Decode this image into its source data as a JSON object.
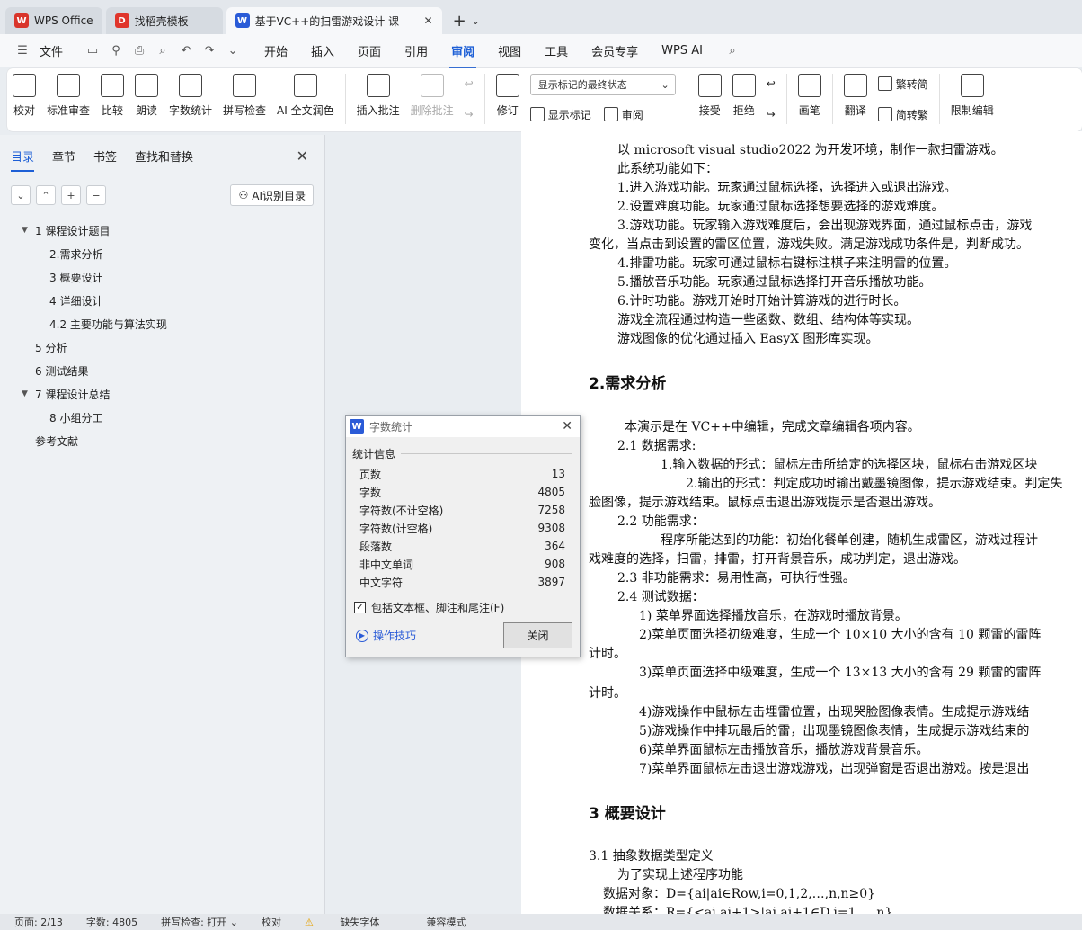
{
  "tabs": [
    {
      "label": "WPS Office",
      "logo": "W",
      "color": "#d9352b"
    },
    {
      "label": "找稻壳模板",
      "logo": "D",
      "color": "#e0352b"
    },
    {
      "label": "基于VC++的扫雷游戏设计 课",
      "logo": "W",
      "color": "#2a5bd7"
    }
  ],
  "menu": {
    "file": "文件",
    "items": [
      "开始",
      "插入",
      "页面",
      "引用",
      "审阅",
      "视图",
      "工具",
      "会员专享",
      "WPS AI"
    ],
    "active_index": 4
  },
  "ribbon": {
    "group1": [
      "校对",
      "标准审查",
      "比较",
      "朗读",
      "字数统计",
      "拼写检查",
      "AI 全文润色"
    ],
    "insert_comment": "插入批注",
    "delete_comment": "删除批注",
    "revise": "修订",
    "markup_select": "显示标记的最终状态",
    "show_markup": "显示标记",
    "review": "审阅",
    "accept": "接受",
    "reject": "拒绝",
    "pen": "画笔",
    "translate": "翻译",
    "to_trad": "繁转简",
    "to_simp": "简转繁",
    "restrict": "限制编辑"
  },
  "nav": {
    "tabs": [
      "目录",
      "章节",
      "书签",
      "查找和替换"
    ],
    "ai_button": "AI识别目录",
    "toc": [
      {
        "label": "1  课程设计题目",
        "level": 0,
        "arrow": true
      },
      {
        "label": "2.需求分析",
        "level": 1,
        "arrow": false
      },
      {
        "label": "3  概要设计",
        "level": 1,
        "arrow": false
      },
      {
        "label": "4 详细设计",
        "level": 1,
        "arrow": false
      },
      {
        "label": "4.2  主要功能与算法实现",
        "level": 1,
        "arrow": false
      },
      {
        "label": "5  分析",
        "level": 0,
        "arrow": false
      },
      {
        "label": "6  测试结果",
        "level": 0,
        "arrow": false
      },
      {
        "label": "7    课程设计总结",
        "level": 0,
        "arrow": true
      },
      {
        "label": "8  小组分工",
        "level": 1,
        "arrow": false
      },
      {
        "label": "参考文献",
        "level": 0,
        "arrow": false
      }
    ]
  },
  "doc": {
    "lines": [
      "以 microsoft visual studio2022 为开发环境，制作一款扫雷游戏。",
      "此系统功能如下：",
      "1.进入游戏功能。玩家通过鼠标选择，选择进入或退出游戏。",
      "2.设置难度功能。玩家通过鼠标选择想要选择的游戏难度。",
      "3.游戏功能。玩家输入游戏难度后，会出现游戏界面，通过鼠标点击，游戏",
      "变化，当点击到设置的雷区位置，游戏失败。满足游戏成功条件是，判断成功。",
      "4.排雷功能。玩家可通过鼠标右键标注棋子来注明雷的位置。",
      "5.播放音乐功能。玩家通过鼠标选择打开音乐播放功能。",
      "6.计时功能。游戏开始时开始计算游戏的进行时长。",
      "游戏全流程通过构造一些函数、数组、结构体等实现。",
      "游戏图像的优化通过插入 EasyX 图形库实现。",
      "本演示是在 VC++中编辑，完成文章编辑各项内容。",
      "2.1  数据需求:",
      "1.输入数据的形式：鼠标左击所给定的选择区块，鼠标右击游戏区块",
      "2.输出的形式：判定成功时输出戴墨镜图像，提示游戏结束。判定失",
      "脸图像，提示游戏结束。鼠标点击退出游戏提示是否退出游戏。",
      "2.2 功能需求：",
      "程序所能达到的功能：初始化餐单创建，随机生成雷区，游戏过程计",
      "戏难度的选择，扫雷，排雷，打开背景音乐，成功判定，退出游戏。",
      "2.3  非功能需求：易用性高，可执行性强。",
      "2.4  测试数据：",
      "1)  菜单界面选择播放音乐，在游戏时播放背景。",
      "2)菜单页面选择初级难度，生成一个 10×10 大小的含有 10 颗雷的雷阵",
      "计时。",
      "3)菜单页面选择中级难度，生成一个 13×13 大小的含有 29 颗雷的雷阵",
      "计时。",
      "4)游戏操作中鼠标左击埋雷位置，出现哭脸图像表情。生成提示游戏结",
      "5)游戏操作中排玩最后的雷，出现墨镜图像表情，生成提示游戏结束的",
      "6)菜单界面鼠标左击播放音乐，播放游戏背景音乐。",
      "7)菜单界面鼠标左击退出游戏游戏，出现弹窗是否退出游戏。按是退出",
      "3.1  抽象数据类型定义",
      "为了实现上述程序功能",
      "数据对象：D={ai|ai∈Row,i=0,1,2,…,n,n≥0}",
      "数据关系：R={<ai,ai+1>|ai,ai+1∈D,i=1,…,n}"
    ],
    "h2": "2.需求分析",
    "h3": "3  概要设计"
  },
  "dialog": {
    "title": "字数统计",
    "section": "统计信息",
    "rows": [
      {
        "k": "页数",
        "v": "13"
      },
      {
        "k": "字数",
        "v": "4805"
      },
      {
        "k": "字符数(不计空格)",
        "v": "7258"
      },
      {
        "k": "字符数(计空格)",
        "v": "9308"
      },
      {
        "k": "段落数",
        "v": "364"
      },
      {
        "k": "非中文单词",
        "v": "908"
      },
      {
        "k": "中文字符",
        "v": "3897"
      }
    ],
    "checkbox": "包括文本框、脚注和尾注(F)",
    "tips": "操作技巧",
    "close": "关闭"
  },
  "status": [
    "页面: 2/13",
    "字数: 4805",
    "拼写检查: 打开 ⌄",
    "校对",
    "缺失字体",
    "兼容模式"
  ]
}
